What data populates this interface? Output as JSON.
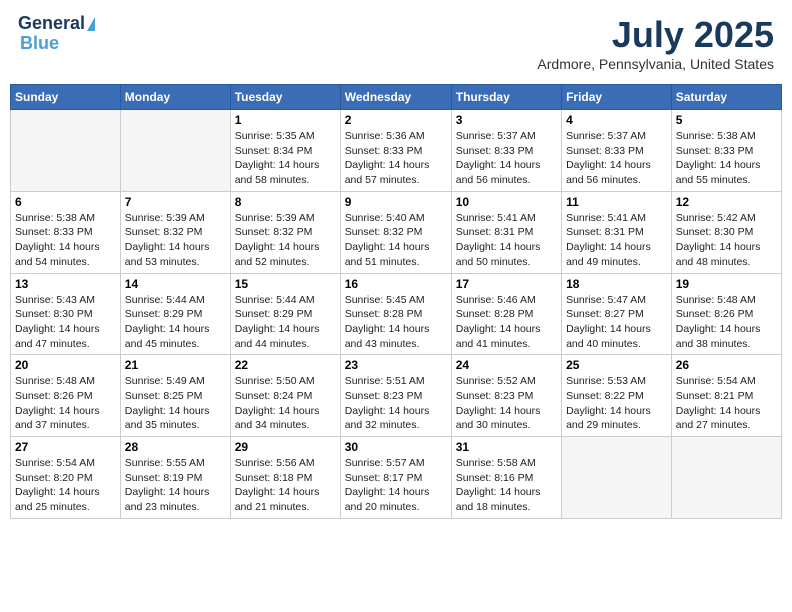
{
  "header": {
    "logo_line1": "General",
    "logo_line2": "Blue",
    "month_title": "July 2025",
    "location": "Ardmore, Pennsylvania, United States"
  },
  "days_of_week": [
    "Sunday",
    "Monday",
    "Tuesday",
    "Wednesday",
    "Thursday",
    "Friday",
    "Saturday"
  ],
  "weeks": [
    [
      {
        "day": "",
        "sunrise": "",
        "sunset": "",
        "daylight": "",
        "empty": true
      },
      {
        "day": "",
        "sunrise": "",
        "sunset": "",
        "daylight": "",
        "empty": true
      },
      {
        "day": "1",
        "sunrise": "Sunrise: 5:35 AM",
        "sunset": "Sunset: 8:34 PM",
        "daylight": "Daylight: 14 hours and 58 minutes."
      },
      {
        "day": "2",
        "sunrise": "Sunrise: 5:36 AM",
        "sunset": "Sunset: 8:33 PM",
        "daylight": "Daylight: 14 hours and 57 minutes."
      },
      {
        "day": "3",
        "sunrise": "Sunrise: 5:37 AM",
        "sunset": "Sunset: 8:33 PM",
        "daylight": "Daylight: 14 hours and 56 minutes."
      },
      {
        "day": "4",
        "sunrise": "Sunrise: 5:37 AM",
        "sunset": "Sunset: 8:33 PM",
        "daylight": "Daylight: 14 hours and 56 minutes."
      },
      {
        "day": "5",
        "sunrise": "Sunrise: 5:38 AM",
        "sunset": "Sunset: 8:33 PM",
        "daylight": "Daylight: 14 hours and 55 minutes."
      }
    ],
    [
      {
        "day": "6",
        "sunrise": "Sunrise: 5:38 AM",
        "sunset": "Sunset: 8:33 PM",
        "daylight": "Daylight: 14 hours and 54 minutes."
      },
      {
        "day": "7",
        "sunrise": "Sunrise: 5:39 AM",
        "sunset": "Sunset: 8:32 PM",
        "daylight": "Daylight: 14 hours and 53 minutes."
      },
      {
        "day": "8",
        "sunrise": "Sunrise: 5:39 AM",
        "sunset": "Sunset: 8:32 PM",
        "daylight": "Daylight: 14 hours and 52 minutes."
      },
      {
        "day": "9",
        "sunrise": "Sunrise: 5:40 AM",
        "sunset": "Sunset: 8:32 PM",
        "daylight": "Daylight: 14 hours and 51 minutes."
      },
      {
        "day": "10",
        "sunrise": "Sunrise: 5:41 AM",
        "sunset": "Sunset: 8:31 PM",
        "daylight": "Daylight: 14 hours and 50 minutes."
      },
      {
        "day": "11",
        "sunrise": "Sunrise: 5:41 AM",
        "sunset": "Sunset: 8:31 PM",
        "daylight": "Daylight: 14 hours and 49 minutes."
      },
      {
        "day": "12",
        "sunrise": "Sunrise: 5:42 AM",
        "sunset": "Sunset: 8:30 PM",
        "daylight": "Daylight: 14 hours and 48 minutes."
      }
    ],
    [
      {
        "day": "13",
        "sunrise": "Sunrise: 5:43 AM",
        "sunset": "Sunset: 8:30 PM",
        "daylight": "Daylight: 14 hours and 47 minutes."
      },
      {
        "day": "14",
        "sunrise": "Sunrise: 5:44 AM",
        "sunset": "Sunset: 8:29 PM",
        "daylight": "Daylight: 14 hours and 45 minutes."
      },
      {
        "day": "15",
        "sunrise": "Sunrise: 5:44 AM",
        "sunset": "Sunset: 8:29 PM",
        "daylight": "Daylight: 14 hours and 44 minutes."
      },
      {
        "day": "16",
        "sunrise": "Sunrise: 5:45 AM",
        "sunset": "Sunset: 8:28 PM",
        "daylight": "Daylight: 14 hours and 43 minutes."
      },
      {
        "day": "17",
        "sunrise": "Sunrise: 5:46 AM",
        "sunset": "Sunset: 8:28 PM",
        "daylight": "Daylight: 14 hours and 41 minutes."
      },
      {
        "day": "18",
        "sunrise": "Sunrise: 5:47 AM",
        "sunset": "Sunset: 8:27 PM",
        "daylight": "Daylight: 14 hours and 40 minutes."
      },
      {
        "day": "19",
        "sunrise": "Sunrise: 5:48 AM",
        "sunset": "Sunset: 8:26 PM",
        "daylight": "Daylight: 14 hours and 38 minutes."
      }
    ],
    [
      {
        "day": "20",
        "sunrise": "Sunrise: 5:48 AM",
        "sunset": "Sunset: 8:26 PM",
        "daylight": "Daylight: 14 hours and 37 minutes."
      },
      {
        "day": "21",
        "sunrise": "Sunrise: 5:49 AM",
        "sunset": "Sunset: 8:25 PM",
        "daylight": "Daylight: 14 hours and 35 minutes."
      },
      {
        "day": "22",
        "sunrise": "Sunrise: 5:50 AM",
        "sunset": "Sunset: 8:24 PM",
        "daylight": "Daylight: 14 hours and 34 minutes."
      },
      {
        "day": "23",
        "sunrise": "Sunrise: 5:51 AM",
        "sunset": "Sunset: 8:23 PM",
        "daylight": "Daylight: 14 hours and 32 minutes."
      },
      {
        "day": "24",
        "sunrise": "Sunrise: 5:52 AM",
        "sunset": "Sunset: 8:23 PM",
        "daylight": "Daylight: 14 hours and 30 minutes."
      },
      {
        "day": "25",
        "sunrise": "Sunrise: 5:53 AM",
        "sunset": "Sunset: 8:22 PM",
        "daylight": "Daylight: 14 hours and 29 minutes."
      },
      {
        "day": "26",
        "sunrise": "Sunrise: 5:54 AM",
        "sunset": "Sunset: 8:21 PM",
        "daylight": "Daylight: 14 hours and 27 minutes."
      }
    ],
    [
      {
        "day": "27",
        "sunrise": "Sunrise: 5:54 AM",
        "sunset": "Sunset: 8:20 PM",
        "daylight": "Daylight: 14 hours and 25 minutes."
      },
      {
        "day": "28",
        "sunrise": "Sunrise: 5:55 AM",
        "sunset": "Sunset: 8:19 PM",
        "daylight": "Daylight: 14 hours and 23 minutes."
      },
      {
        "day": "29",
        "sunrise": "Sunrise: 5:56 AM",
        "sunset": "Sunset: 8:18 PM",
        "daylight": "Daylight: 14 hours and 21 minutes."
      },
      {
        "day": "30",
        "sunrise": "Sunrise: 5:57 AM",
        "sunset": "Sunset: 8:17 PM",
        "daylight": "Daylight: 14 hours and 20 minutes."
      },
      {
        "day": "31",
        "sunrise": "Sunrise: 5:58 AM",
        "sunset": "Sunset: 8:16 PM",
        "daylight": "Daylight: 14 hours and 18 minutes."
      },
      {
        "day": "",
        "sunrise": "",
        "sunset": "",
        "daylight": "",
        "empty": true
      },
      {
        "day": "",
        "sunrise": "",
        "sunset": "",
        "daylight": "",
        "empty": true
      }
    ]
  ]
}
